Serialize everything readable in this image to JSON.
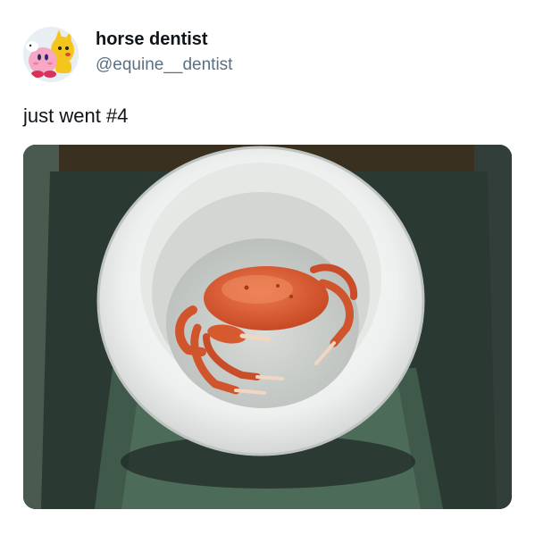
{
  "tweet": {
    "display_name": "horse dentist",
    "handle": "@equine__dentist",
    "text": "just went #4",
    "avatar_icon": "cartoon-avatar-icon",
    "media_icon": "crab-in-toilet-photo"
  },
  "colors": {
    "text_primary": "#0f1419",
    "text_secondary": "#5b7083",
    "background": "#ffffff"
  }
}
